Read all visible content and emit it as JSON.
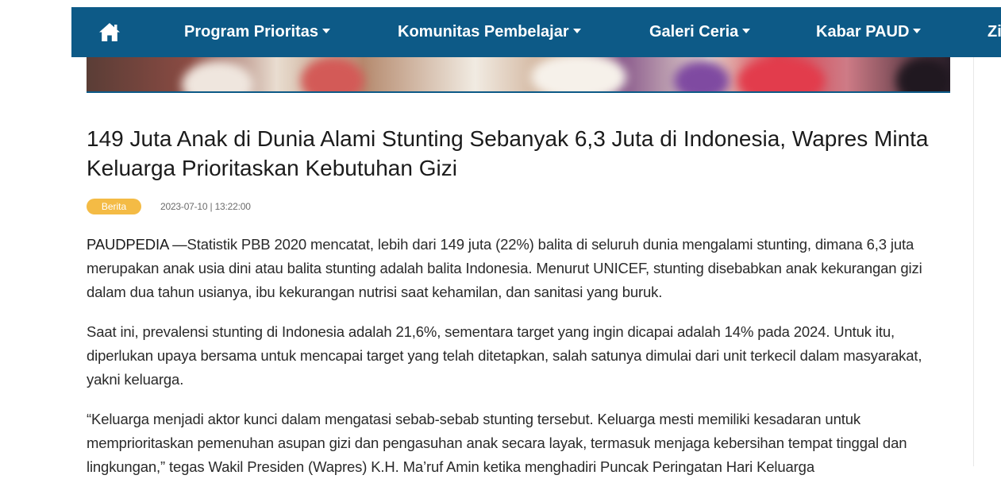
{
  "nav": {
    "items": [
      {
        "label": "Program Prioritas"
      },
      {
        "label": "Komunitas Pembelajar"
      },
      {
        "label": "Galeri Ceria"
      },
      {
        "label": "Kabar PAUD"
      },
      {
        "label": "Zi"
      }
    ]
  },
  "article": {
    "title": "149 Juta Anak di Dunia Alami Stunting Sebanyak 6,3 Juta di Indonesia, Wapres Minta Keluarga Prioritaskan Kebutuhan Gizi",
    "category": "Berita",
    "datetime": "2023-07-10 | 13:22:00",
    "lead": "PAUDPEDIA —",
    "paragraph_1": "Statistik PBB 2020 mencatat, lebih dari 149 juta (22%) balita di seluruh dunia mengalami stunting, dimana 6,3 juta merupakan anak usia dini atau balita stunting adalah balita Indonesia. Menurut UNICEF, stunting disebabkan anak kekurangan gizi dalam dua tahun usianya, ibu kekurangan nutrisi saat kehamilan, dan sanitasi yang buruk.",
    "paragraph_2": "Saat ini, prevalensi stunting di Indonesia adalah 21,6%, sementara target yang ingin dicapai adalah 14% pada 2024. Untuk itu, diperlukan upaya bersama untuk mencapai target yang telah ditetapkan, salah satunya dimulai dari unit terkecil dalam masyarakat, yakni keluarga.",
    "paragraph_3": "“Keluarga menjadi aktor kunci dalam mengatasi sebab-sebab stunting tersebut. Keluarga mesti memiliki kesadaran untuk memprioritaskan pemenuhan asupan gizi dan pengasuhan anak secara layak, termasuk menjaga kebersihan tempat tinggal dan lingkungan,” tegas Wakil Presiden (Wapres) K.H. Ma’ruf Amin ketika menghadiri Puncak Peringatan Hari Keluarga"
  },
  "colors": {
    "nav_bg": "#0d5a87",
    "badge_bg": "#f4bb45"
  },
  "icons": {
    "home": "home-icon",
    "dropdown": "caret-down-icon"
  }
}
